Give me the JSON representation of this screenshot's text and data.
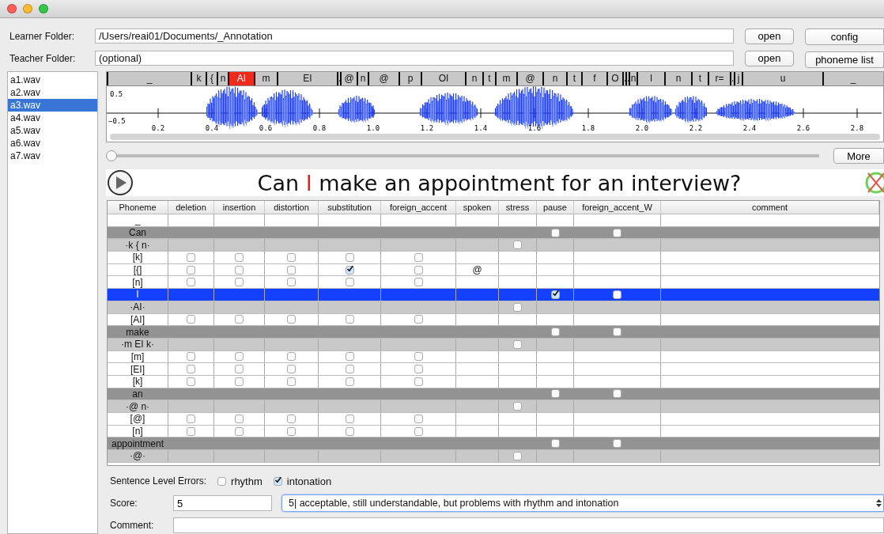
{
  "folders": [
    {
      "label": "Learner Folder:",
      "value": "/Users/reai01/Documents/_Annotation",
      "button": "open"
    },
    {
      "label": "Teacher Folder:",
      "placeholder": "(optional)",
      "button": "open"
    }
  ],
  "side_buttons": [
    "config",
    "phoneme list"
  ],
  "files": [
    {
      "name": "a1.wav",
      "selected": false
    },
    {
      "name": "a2.wav",
      "selected": false
    },
    {
      "name": "a3.wav",
      "selected": true
    },
    {
      "name": "a4.wav",
      "selected": false
    },
    {
      "name": "a5.wav",
      "selected": false
    },
    {
      "name": "a6.wav",
      "selected": false
    },
    {
      "name": "a7.wav",
      "selected": false
    }
  ],
  "segments": [
    {
      "label": "_",
      "selected": false
    },
    {
      "label": "k",
      "selected": false
    },
    {
      "label": "{",
      "selected": false
    },
    {
      "label": "n",
      "selected": false
    },
    {
      "label": "AI",
      "selected": true
    },
    {
      "label": "m",
      "selected": false
    },
    {
      "label": "EI",
      "selected": false
    },
    {
      "label": ".",
      "selected": false
    },
    {
      "label": "@",
      "selected": false
    },
    {
      "label": "n",
      "selected": false
    },
    {
      "label": "@",
      "selected": false
    },
    {
      "label": "p",
      "selected": false
    },
    {
      "label": "OI",
      "selected": false
    },
    {
      "label": "n",
      "selected": false
    },
    {
      "label": "t",
      "selected": false
    },
    {
      "label": "m",
      "selected": false
    },
    {
      "label": "@",
      "selected": false
    },
    {
      "label": "n",
      "selected": false
    },
    {
      "label": "t",
      "selected": false
    },
    {
      "label": "f",
      "selected": false
    },
    {
      "label": "O",
      "selected": false
    },
    {
      "label": ".",
      "selected": false
    },
    {
      "label": ".",
      "selected": false
    },
    {
      "label": "n",
      "selected": false
    },
    {
      "label": "l",
      "selected": false
    },
    {
      "label": "n",
      "selected": false
    },
    {
      "label": "t",
      "selected": false
    },
    {
      "label": "r=",
      "selected": false
    },
    {
      "label": ".",
      "selected": false
    },
    {
      "label": "j",
      "selected": false
    },
    {
      "label": "u",
      "selected": false
    },
    {
      "label": "_",
      "selected": false
    }
  ],
  "waveform": {
    "y_ticks": [
      "0.5",
      "−0.5"
    ],
    "x_ticks": [
      "0.2",
      "0.4",
      "0.6",
      "0.8",
      "1.0",
      "1.2",
      "1.4",
      "1.6",
      "1.8",
      "2.0",
      "2.2",
      "2.4",
      "2.6",
      "2.8"
    ]
  },
  "position_slider": {
    "level": 0
  },
  "more_button": "More",
  "sentence": [
    {
      "text": "Can",
      "selected": false
    },
    {
      "text": "I",
      "selected": true
    },
    {
      "text": "make",
      "selected": false
    },
    {
      "text": "an",
      "selected": false
    },
    {
      "text": "appointment",
      "selected": false
    },
    {
      "text": "for",
      "selected": false
    },
    {
      "text": "an",
      "selected": false
    },
    {
      "text": "interview?",
      "selected": false
    }
  ],
  "table": {
    "columns": [
      "Phoneme",
      "deletion",
      "insertion",
      "distortion",
      "substitution",
      "foreign_accent",
      "spoken",
      "stress",
      "pause",
      "foreign_accent_W",
      "comment"
    ],
    "rows": [
      {
        "kind": "blank",
        "label": "_",
        "selected": false
      },
      {
        "kind": "word",
        "label": "Can",
        "selected": false,
        "pause": false,
        "foreign_accent_W": false
      },
      {
        "kind": "syllable",
        "label": "·k { n·",
        "selected": false,
        "stress": false
      },
      {
        "kind": "phone",
        "label": "[k]",
        "selected": false,
        "deletion": false,
        "insertion": false,
        "distortion": false,
        "substitution": false,
        "foreign_accent": false
      },
      {
        "kind": "phone",
        "label": "[{]",
        "selected": false,
        "deletion": false,
        "insertion": false,
        "distortion": false,
        "substitution": true,
        "foreign_accent": false,
        "spoken": "@"
      },
      {
        "kind": "phone",
        "label": "[n]",
        "selected": false,
        "deletion": false,
        "insertion": false,
        "distortion": false,
        "substitution": false,
        "foreign_accent": false
      },
      {
        "kind": "word",
        "label": "I",
        "selected": true,
        "pause": true,
        "foreign_accent_W": false
      },
      {
        "kind": "syllable",
        "label": "·AI·",
        "selected": false,
        "stress": false
      },
      {
        "kind": "phone",
        "label": "[AI]",
        "selected": false,
        "deletion": false,
        "insertion": false,
        "distortion": false,
        "substitution": false,
        "foreign_accent": false
      },
      {
        "kind": "word",
        "label": "make",
        "selected": false,
        "pause": false,
        "foreign_accent_W": false
      },
      {
        "kind": "syllable",
        "label": "·m EI k·",
        "selected": false,
        "stress": false
      },
      {
        "kind": "phone",
        "label": "[m]",
        "selected": false,
        "deletion": false,
        "insertion": false,
        "distortion": false,
        "substitution": false,
        "foreign_accent": false
      },
      {
        "kind": "phone",
        "label": "[EI]",
        "selected": false,
        "deletion": false,
        "insertion": false,
        "distortion": false,
        "substitution": false,
        "foreign_accent": false
      },
      {
        "kind": "phone",
        "label": "[k]",
        "selected": false,
        "deletion": false,
        "insertion": false,
        "distortion": false,
        "substitution": false,
        "foreign_accent": false
      },
      {
        "kind": "word",
        "label": "an",
        "selected": false,
        "pause": false,
        "foreign_accent_W": false
      },
      {
        "kind": "syllable",
        "label": "·@ n·",
        "selected": false,
        "stress": false
      },
      {
        "kind": "phone",
        "label": "[@]",
        "selected": false,
        "deletion": false,
        "insertion": false,
        "distortion": false,
        "substitution": false,
        "foreign_accent": false
      },
      {
        "kind": "phone",
        "label": "[n]",
        "selected": false,
        "deletion": false,
        "insertion": false,
        "distortion": false,
        "substitution": false,
        "foreign_accent": false
      },
      {
        "kind": "word",
        "label": "appointment",
        "selected": false,
        "pause": false,
        "foreign_accent_W": false
      },
      {
        "kind": "syllable",
        "label": "·@·",
        "selected": false,
        "stress": false
      }
    ]
  },
  "sentence_errors": {
    "label": "Sentence Level Errors:",
    "options": [
      {
        "label": "rhythm",
        "checked": false
      },
      {
        "label": "intonation",
        "checked": true
      }
    ]
  },
  "score": {
    "label": "Score:",
    "value": "5",
    "choice": "5|  acceptable, still understandable, but problems with rhythm and intonation"
  },
  "comment": {
    "label": "Comment:"
  }
}
